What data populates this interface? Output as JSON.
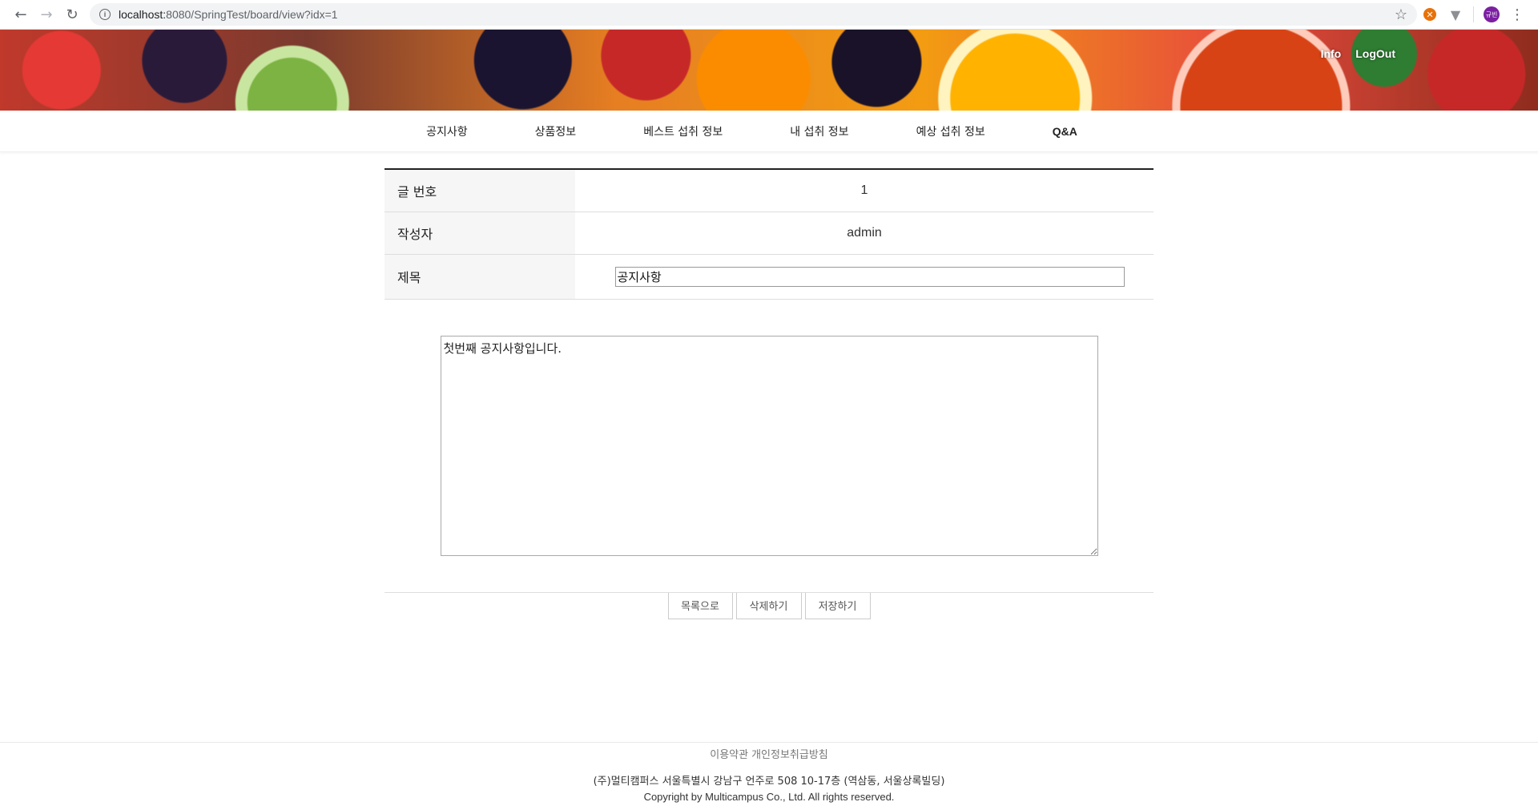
{
  "browser": {
    "url_host": "localhost:",
    "url_path": "8080/SpringTest/board/view?idx=1",
    "avatar_text": "규빈"
  },
  "header": {
    "info_link": "Info",
    "logout_link": "LogOut"
  },
  "nav": {
    "items": [
      {
        "label": "공지사항"
      },
      {
        "label": "상품정보"
      },
      {
        "label": "베스트 섭취 정보"
      },
      {
        "label": "내 섭취 정보"
      },
      {
        "label": "예상 섭취 정보"
      },
      {
        "label": "Q&A"
      }
    ]
  },
  "post": {
    "number_label": "글 번호",
    "number_value": "1",
    "author_label": "작성자",
    "author_value": "admin",
    "title_label": "제목",
    "title_value": "공지사항",
    "body_value": "첫번째 공지사항입니다."
  },
  "actions": {
    "list_label": "목록으로",
    "delete_label": "삭제하기",
    "save_label": "저장하기"
  },
  "footer": {
    "terms": "이용약관",
    "privacy": "개인정보취급방침",
    "address": "(주)멀티캠퍼스 서울특별시 강남구 언주로 508 10-17층 (역삼동, 서울상록빌딩)",
    "copyright": "Copyright by Multicampus Co., Ltd. All rights reserved."
  }
}
